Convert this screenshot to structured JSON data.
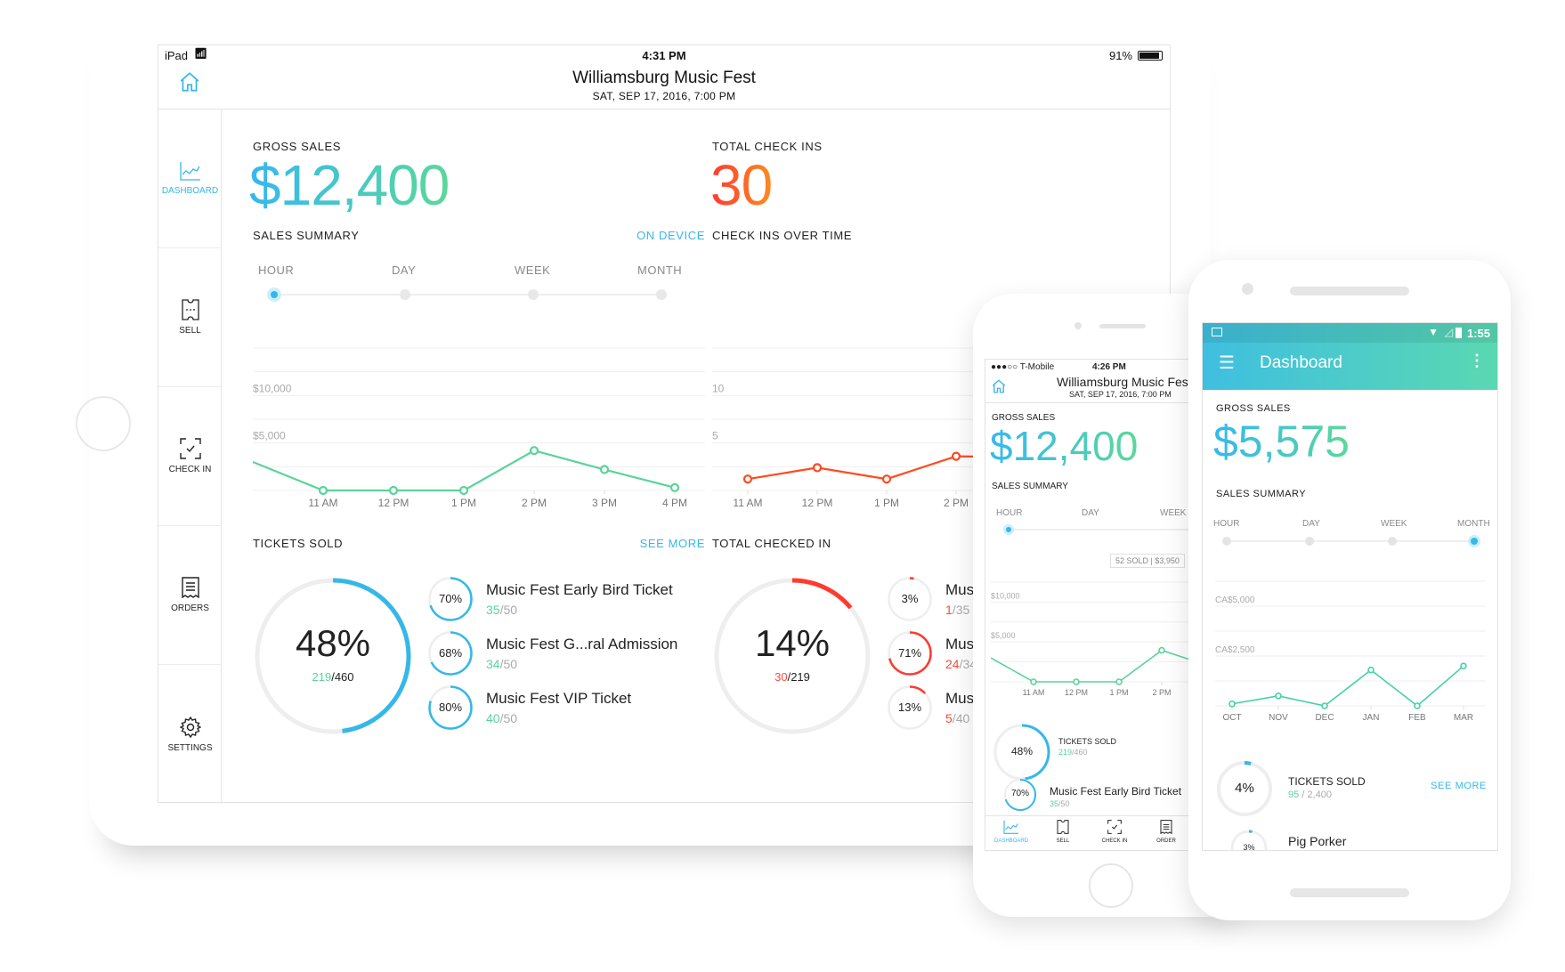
{
  "colors": {
    "accent_blue": "#35b8e8",
    "accent_green": "#5ad39b",
    "accent_red": "#ff4a3d",
    "accent_orange": "#ff8a1f"
  },
  "ipad": {
    "status": {
      "device": "iPad",
      "time": "4:31 PM",
      "battery": "91%"
    },
    "header": {
      "title": "Williamsburg Music Fest",
      "subtitle": "SAT, SEP 17, 2016, 7:00 PM",
      "home_icon": "home-icon"
    },
    "sidebar": [
      {
        "label": "DASHBOARD",
        "icon": "chart-line-icon",
        "active": true
      },
      {
        "label": "SELL",
        "icon": "ticket-icon",
        "active": false
      },
      {
        "label": "CHECK IN",
        "icon": "scan-check-icon",
        "active": false
      },
      {
        "label": "ORDERS",
        "icon": "receipt-icon",
        "active": false
      },
      {
        "label": "SETTINGS",
        "icon": "gear-icon",
        "active": false
      }
    ],
    "gross_sales": {
      "label": "GROSS SALES",
      "value": "$12,400"
    },
    "total_check_ins": {
      "label": "TOTAL CHECK INS",
      "value": "30"
    },
    "sales_summary": {
      "label": "SALES SUMMARY",
      "link": "ON DEVICE",
      "ranges": [
        "HOUR",
        "DAY",
        "WEEK",
        "MONTH"
      ],
      "selected": "HOUR"
    },
    "check_ins_over_time": {
      "label": "CHECK INS OVER TIME"
    },
    "tickets_sold": {
      "label": "TICKETS SOLD",
      "link": "SEE MORE",
      "percent": "48%",
      "sold": "219",
      "total": "460",
      "fraction": 0.48,
      "items": [
        {
          "name": "Music Fest Early Bird Ticket",
          "percent": "70%",
          "sold": "35",
          "total": "50",
          "fraction": 0.7
        },
        {
          "name": "Music Fest G...ral Admission",
          "percent": "68%",
          "sold": "34",
          "total": "50",
          "fraction": 0.68
        },
        {
          "name": "Music Fest VIP Ticket",
          "percent": "80%",
          "sold": "40",
          "total": "50",
          "fraction": 0.8
        }
      ]
    },
    "total_checked_in": {
      "label": "TOTAL CHECKED IN",
      "percent": "14%",
      "checked": "30",
      "total": "219",
      "fraction": 0.14,
      "items": [
        {
          "name": "Mus",
          "percent": "3%",
          "checked": "1",
          "total": "35",
          "fraction": 0.03
        },
        {
          "name": "Mus",
          "percent": "71%",
          "checked": "24",
          "total": "34",
          "fraction": 0.71
        },
        {
          "name": "Mus",
          "percent": "13%",
          "checked": "5",
          "total": "40",
          "fraction": 0.13
        }
      ]
    }
  },
  "iphone": {
    "status": {
      "carrier": "●●●○○ T-Mobile",
      "time": "4:26 PM"
    },
    "header": {
      "title": "Williamsburg Music Fes",
      "subtitle": "SAT, SEP 17, 2016, 7:00 PM"
    },
    "gross_sales": {
      "label": "GROSS SALES",
      "value": "$12,400"
    },
    "sales_summary": {
      "label": "SALES SUMMARY",
      "ranges": [
        "HOUR",
        "DAY",
        "WEEK"
      ],
      "selected": "HOUR"
    },
    "tooltip": "52 SOLD | $3,950",
    "tickets_sold": {
      "label": "TICKETS SOLD",
      "percent": "48%",
      "sold": "219",
      "total": "460",
      "fraction": 0.48
    },
    "item": {
      "name": "Music Fest Early Bird Ticket",
      "percent": "70%",
      "sold": "35",
      "total": "50",
      "fraction": 0.7
    },
    "tabbar": [
      "DASHBOARD",
      "SELL",
      "CHECK IN",
      "ORDER"
    ]
  },
  "android": {
    "status": {
      "time": "1:55"
    },
    "appbar": {
      "title": "Dashboard"
    },
    "gross_sales": {
      "label": "GROSS SALES",
      "value": "$5,575"
    },
    "sales_summary": {
      "label": "SALES SUMMARY",
      "ranges": [
        "HOUR",
        "DAY",
        "WEEK",
        "MONTH"
      ],
      "selected": "MONTH"
    },
    "tickets_sold": {
      "label": "TICKETS SOLD",
      "link": "SEE MORE",
      "percent": "4%",
      "sold": "95",
      "total": "2,400",
      "fraction": 0.04
    },
    "item": {
      "name": "Pig Porker",
      "percent": "3%",
      "fraction": 0.03
    }
  },
  "chart_data": [
    {
      "id": "ipad-sales",
      "type": "line",
      "title": "SALES SUMMARY",
      "categories": [
        "",
        "11 AM",
        "12 PM",
        "1 PM",
        "2 PM",
        "3 PM",
        "4 PM"
      ],
      "values": [
        3000,
        0,
        0,
        0,
        4200,
        2200,
        300
      ],
      "ytick_labels": [
        "$5,000",
        "$10,000"
      ],
      "yticks": [
        5000,
        10000
      ],
      "ylim": [
        0,
        15000
      ],
      "color": "#5ad39b"
    },
    {
      "id": "ipad-checkins",
      "type": "line",
      "title": "CHECK INS OVER TIME",
      "categories": [
        "11 AM",
        "12 PM",
        "1 PM",
        "2 PM",
        ""
      ],
      "values": [
        1.2,
        2.4,
        1.2,
        3.6,
        3.5
      ],
      "ytick_labels": [
        "5",
        "10"
      ],
      "yticks": [
        5,
        10
      ],
      "ylim": [
        0,
        15
      ],
      "color": "#ff4a1d"
    },
    {
      "id": "iphone-sales",
      "type": "line",
      "categories": [
        "",
        "11 AM",
        "12 PM",
        "1 PM",
        "2 PM",
        "3"
      ],
      "values": [
        3000,
        0,
        0,
        0,
        3950,
        2200
      ],
      "ytick_labels": [
        "$5,000",
        "$10,000"
      ],
      "yticks": [
        5000,
        10000
      ],
      "ylim": [
        0,
        12500
      ],
      "color": "#5ad39b"
    },
    {
      "id": "android-sales",
      "type": "line",
      "categories": [
        "OCT",
        "NOV",
        "DEC",
        "JAN",
        "FEB",
        "MAR"
      ],
      "values": [
        100,
        500,
        0,
        1800,
        0,
        2000
      ],
      "ytick_labels": [
        "CA$2,500",
        "CA$5,000"
      ],
      "yticks": [
        2500,
        5000
      ],
      "ylim": [
        0,
        6250
      ],
      "color": "#45d1a8"
    }
  ]
}
